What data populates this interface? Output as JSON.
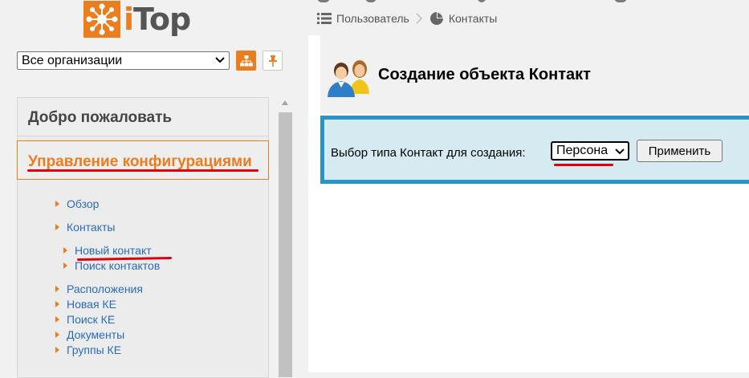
{
  "brand": {
    "logo_text_left": "i",
    "logo_text_right": "Top",
    "accent_color": "#ea7d1e",
    "link_color": "#2a6cbc",
    "highlight_color": "#e00010"
  },
  "org_selector": {
    "selected": "Все организации",
    "tree_icon": "org-tree-icon",
    "pin_icon": "pin-icon"
  },
  "menu": {
    "welcome": "Добро пожаловать",
    "config_management": "Управление конфигурациями",
    "items": [
      {
        "label": "Обзор"
      },
      {
        "label": "Контакты"
      },
      {
        "label": "Новый контакт"
      },
      {
        "label": "Поиск контактов"
      },
      {
        "label": "Расположения"
      },
      {
        "label": "Новая КЕ"
      },
      {
        "label": "Поиск КЕ"
      },
      {
        "label": "Документы"
      },
      {
        "label": "Группы КЕ"
      }
    ]
  },
  "breadcrumb": {
    "items": [
      {
        "label": "Пользователь",
        "icon": "list-icon"
      },
      {
        "label": "Контакты",
        "icon": "pie-chart-icon"
      }
    ]
  },
  "page": {
    "title": "Создание объекта Контакт",
    "icon": "contacts-icon"
  },
  "type_form": {
    "label": "Выбор типа Контакт для создания:",
    "selected_type": "Персона",
    "apply_label": "Применить"
  }
}
